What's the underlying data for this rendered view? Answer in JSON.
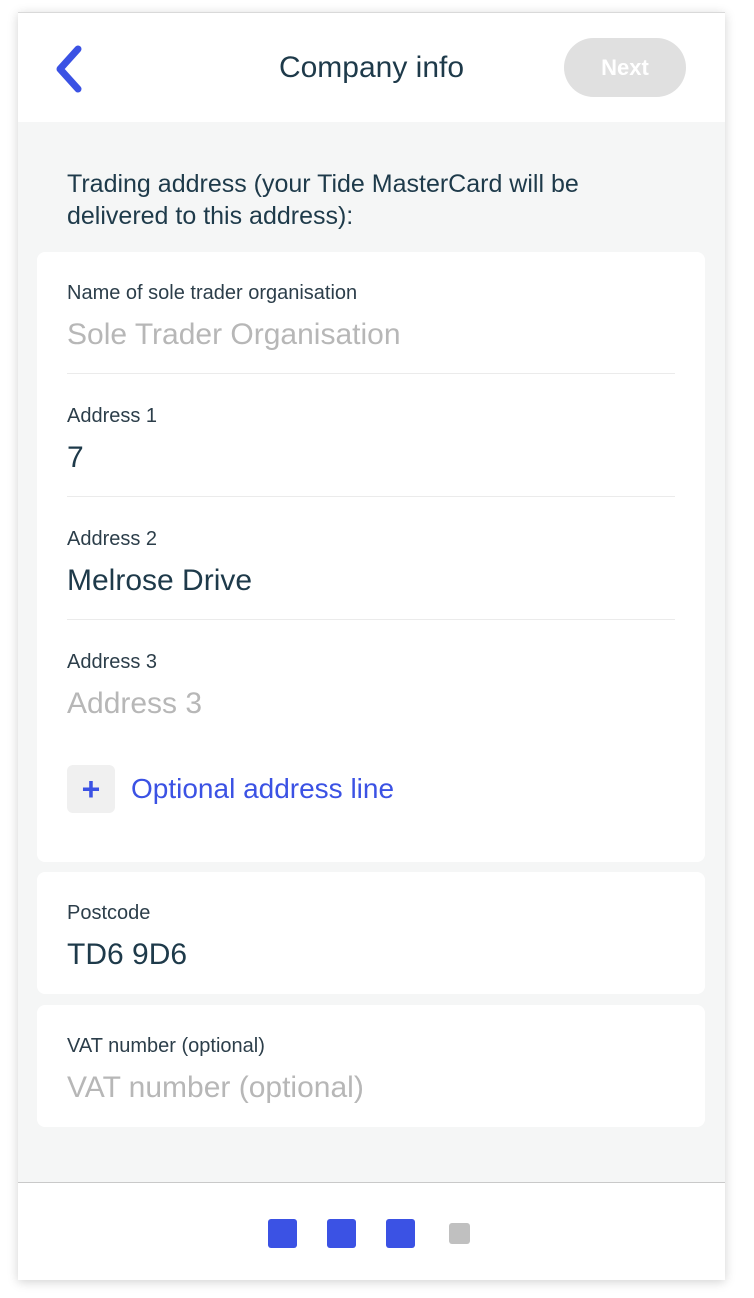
{
  "header": {
    "title": "Company info",
    "next_label": "Next",
    "back_icon": "chevron-left-icon"
  },
  "section": {
    "title": "Trading address (your Tide MasterCard will be delivered to this address):"
  },
  "fields": {
    "org_name": {
      "label": "Name of sole trader organisation",
      "value": "",
      "placeholder": "Sole Trader Organisation"
    },
    "address1": {
      "label": "Address 1",
      "value": "7",
      "placeholder": ""
    },
    "address2": {
      "label": "Address 2",
      "value": "Melrose Drive",
      "placeholder": ""
    },
    "address3": {
      "label": "Address 3",
      "value": "",
      "placeholder": "Address 3"
    },
    "postcode": {
      "label": "Postcode",
      "value": "TD6 9D6",
      "placeholder": ""
    },
    "vat": {
      "label": "VAT number (optional)",
      "value": "",
      "placeholder": "VAT number (optional)"
    }
  },
  "add_line": {
    "label": "Optional address line",
    "icon": "plus-icon"
  },
  "progress": {
    "total_steps": 4,
    "completed_steps": 3
  },
  "colors": {
    "accent": "#3b52e4",
    "text": "#1e3a4a",
    "placeholder": "#b7b7b7",
    "disabled_button": "#e0e0e0",
    "background": "#f5f6f6"
  }
}
